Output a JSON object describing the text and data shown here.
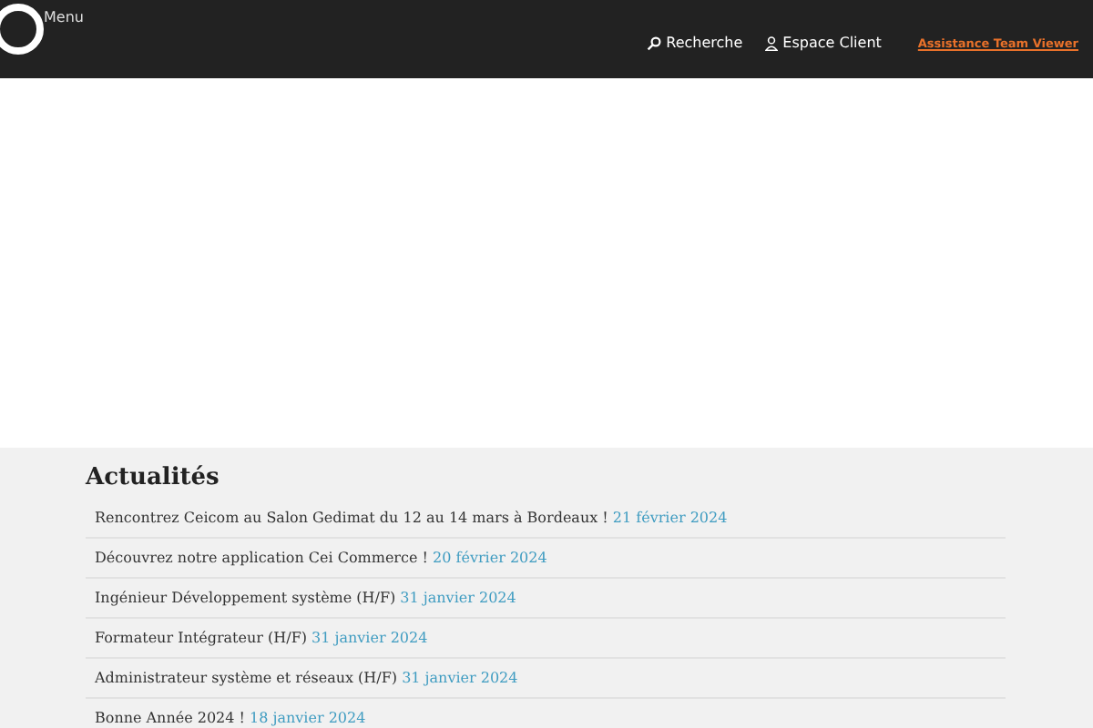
{
  "header": {
    "menu_label": "Menu",
    "links": [
      {
        "kind": "search",
        "label": "Recherche"
      },
      {
        "kind": "user",
        "label": "Espace Client"
      },
      {
        "kind": "highlight",
        "label": "Assistance Team Viewer"
      }
    ]
  },
  "news": {
    "title": "Actualités",
    "items": [
      {
        "title": "Rencontrez Ceicom au Salon Gedimat du 12 au 14 mars à Bordeaux !",
        "date": "21 février 2024"
      },
      {
        "title": "Découvrez notre application Cei Commerce !",
        "date": "20 février 2024"
      },
      {
        "title": "Ingénieur Développement système (H/F)",
        "date": "31 janvier 2024"
      },
      {
        "title": "Formateur Intégrateur (H/F)",
        "date": "31 janvier 2024"
      },
      {
        "title": "Administrateur système et réseaux (H/F)",
        "date": "31 janvier 2024"
      },
      {
        "title": "Bonne Année 2024 !",
        "date": "18 janvier 2024"
      }
    ]
  }
}
